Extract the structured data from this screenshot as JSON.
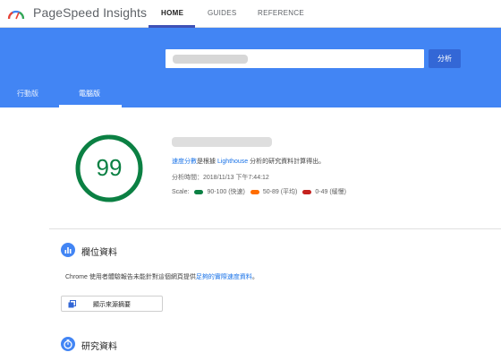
{
  "header": {
    "brand": "PageSpeed Insights",
    "nav_tabs": [
      {
        "label": "HOME",
        "active": true
      },
      {
        "label": "GUIDES",
        "active": false
      },
      {
        "label": "REFERENCE",
        "active": false
      }
    ]
  },
  "banner": {
    "url_placeholder": "",
    "analyze_label": "分析",
    "device_tabs": [
      {
        "label": "行動版",
        "active": false
      },
      {
        "label": "電腦版",
        "active": true
      }
    ]
  },
  "score": {
    "value": "99",
    "fraction": 0.99,
    "color": "#0b8043",
    "desc_link": "速度分數",
    "desc_mid": "是根據 ",
    "desc_lighthouse": "Lighthouse",
    "desc_tail": " 分析的研究資料計算得出。",
    "analysis_time": "分析時間：2018/11/13 下午7:44:12",
    "scale_label": "Scale:",
    "scale": [
      {
        "label": "90-100 (快速)",
        "color": "#0b8043"
      },
      {
        "label": "50-89 (平均)",
        "color": "#ff6d00"
      },
      {
        "label": "0-49 (緩慢)",
        "color": "#c5221f"
      }
    ]
  },
  "field_data": {
    "title": "欄位資料",
    "desc": "Chrome 使用者體驗報告未能針對這個網頁提供",
    "desc_link": "足夠的實際速度資料",
    "desc_end": "。",
    "origin_button": "顯示來源摘要"
  },
  "lab_data": {
    "title": "研究資料"
  },
  "colors": {
    "banner": "#4285f4",
    "accent": "#3367d6",
    "nav_indicator": "#3f51b5"
  }
}
